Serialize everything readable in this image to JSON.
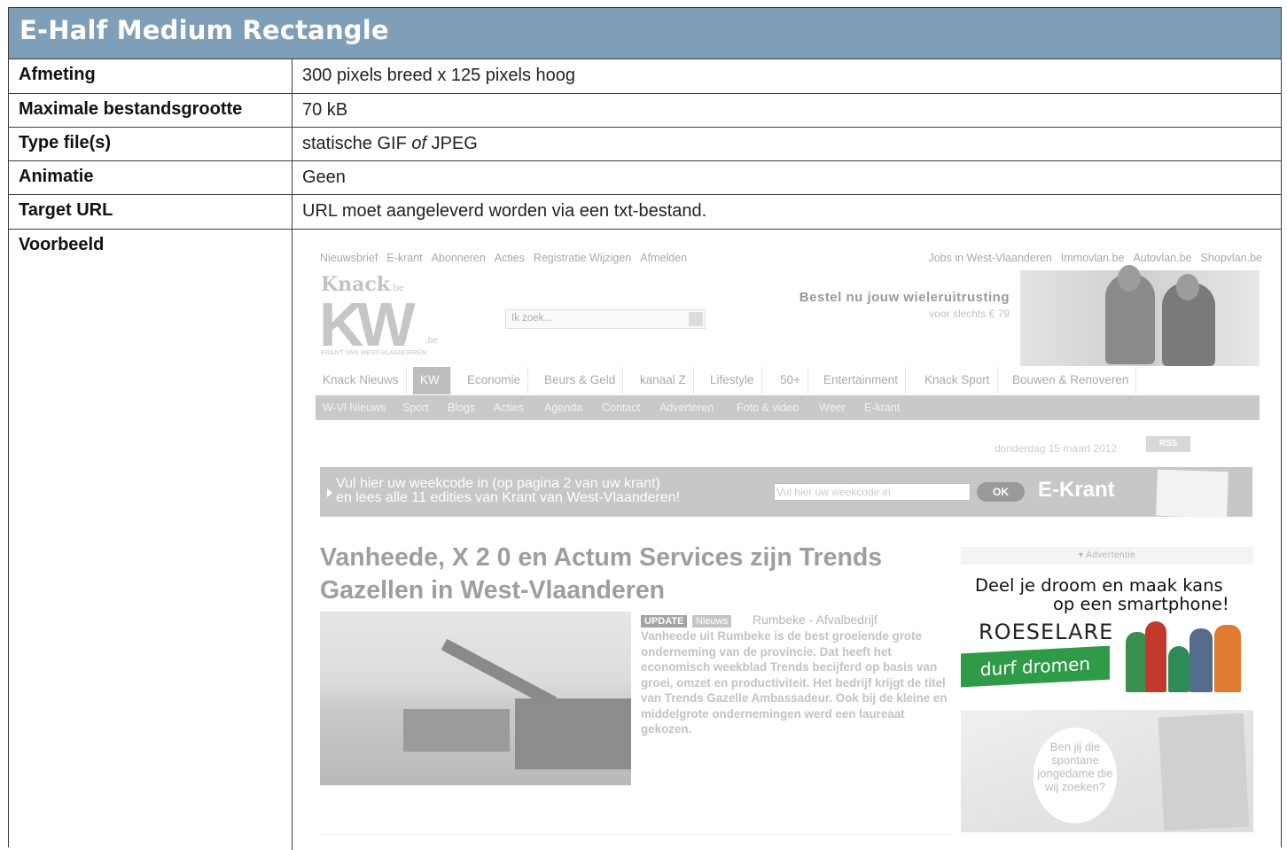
{
  "title": "E-Half Medium Rectangle",
  "rows": [
    {
      "key": "Afmeting",
      "value": "300 pixels breed x 125 pixels hoog"
    },
    {
      "key": "Maximale bestandsgrootte",
      "value": "70 kB"
    },
    {
      "key": "Type file(s)",
      "value_prefix": "statische GIF ",
      "value_italic": "of",
      "value_suffix": " JPEG"
    },
    {
      "key": "Animatie",
      "value": "Geen"
    },
    {
      "key": "Target URL",
      "value": "URL moet aangeleverd worden via een txt-bestand."
    },
    {
      "key": "Voorbeeld"
    }
  ],
  "example": {
    "top_links_left": [
      "Nieuwsbrief",
      "E-krant",
      "Abonneren",
      "Acties",
      "Registratie Wijzigen",
      "Afmelden"
    ],
    "top_links_right": [
      "Jobs in West-Vlaanderen",
      "Immovlan.be",
      "Autovlan.be",
      "Shopvlan.be"
    ],
    "logo_knack": "Knack",
    "logo_knack_be": ".be",
    "logo_kw": "KW",
    "logo_kw_be": ".be",
    "logo_kw_sub": "KRANT VAN WEST-VLAANDEREN",
    "search_placeholder": "Ik zoek...",
    "promo_title": "Bestel nu jouw wieleruitrusting",
    "promo_sub": "voor slechts € 79",
    "nav_main": [
      "Knack Nieuws",
      "KW",
      "Economie",
      "Beurs & Geld",
      "kanaal Z",
      "Lifestyle",
      "50+",
      "Entertainment",
      "Knack Sport",
      "Bouwen & Renoveren"
    ],
    "nav_sub": [
      "W-Vl Nieuws",
      "Sport",
      "Blogs",
      "Acties",
      "Agenda",
      "Contact",
      "Adverteren",
      "Foto & video",
      "Weer",
      "E-krant"
    ],
    "date": "donderdag 15 maart 2012",
    "rss": "RSS",
    "weekcode_line1": "Vul hier uw weekcode in (op pagina 2 van uw krant)",
    "weekcode_line2": "en lees alle 11 edities van Krant van West-Vlaanderen!",
    "weekcode_placeholder": "Vul hier uw weekcode in",
    "ok": "OK",
    "ekrant": "E-Krant",
    "headline": "Vanheede, X 2 0 en Actum Services zijn Trends Gazellen in West-Vlaanderen",
    "tag_update": "UPDATE",
    "tag_news": "Nieuws",
    "location": "Rumbeke - Afvalbedrijf",
    "article": "Vanheede uit Rumbeke is de best groeiende grote onderneming van de provincie. Dat heeft het economisch weekblad Trends becijferd op basis van groei, omzet en productiviteit. Het bedrijf krijgt de titel van Trends Gazelle Ambassadeur. Ook bij de kleine en middelgrote ondernemingen werd een laureaat gekozen.",
    "ad_label": "▾ Advertentie",
    "ad1_line1": "Deel je droom en maak kans",
    "ad1_line2": "op een smartphone!",
    "ad1_brand": "ROESELARE",
    "ad1_cta": "durf dromen",
    "ad2_text": "Ben jij die spontane jongedame die wij zoeken?"
  }
}
